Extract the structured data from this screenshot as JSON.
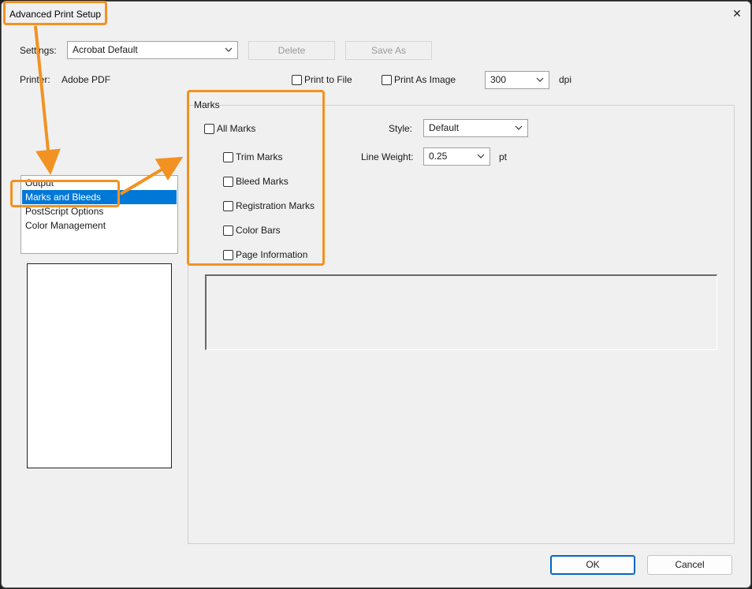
{
  "window": {
    "title": "Advanced Print Setup",
    "close_glyph": "✕"
  },
  "settings": {
    "label": "Settings:",
    "value": "Acrobat Default",
    "delete_label": "Delete",
    "save_as_label": "Save As"
  },
  "printer": {
    "label": "Printer:",
    "value": "Adobe PDF",
    "print_to_file_label": "Print to File",
    "print_as_image_label": "Print As Image",
    "dpi_value": "300",
    "dpi_unit": "dpi"
  },
  "nav": {
    "items": [
      {
        "label": "Output",
        "selected": false
      },
      {
        "label": "Marks and Bleeds",
        "selected": true
      },
      {
        "label": "PostScript Options",
        "selected": false
      },
      {
        "label": "Color Management",
        "selected": false
      }
    ]
  },
  "marks": {
    "group_label": "Marks",
    "all_marks_label": "All Marks",
    "trim_marks_label": "Trim Marks",
    "bleed_marks_label": "Bleed Marks",
    "registration_marks_label": "Registration Marks",
    "color_bars_label": "Color Bars",
    "page_information_label": "Page Information",
    "style_label": "Style:",
    "style_value": "Default",
    "line_weight_label": "Line Weight:",
    "line_weight_value": "0.25",
    "line_weight_unit": "pt"
  },
  "footer": {
    "ok_label": "OK",
    "cancel_label": "Cancel"
  },
  "colors": {
    "annotation": "#f29222",
    "selection": "#0078d7"
  }
}
